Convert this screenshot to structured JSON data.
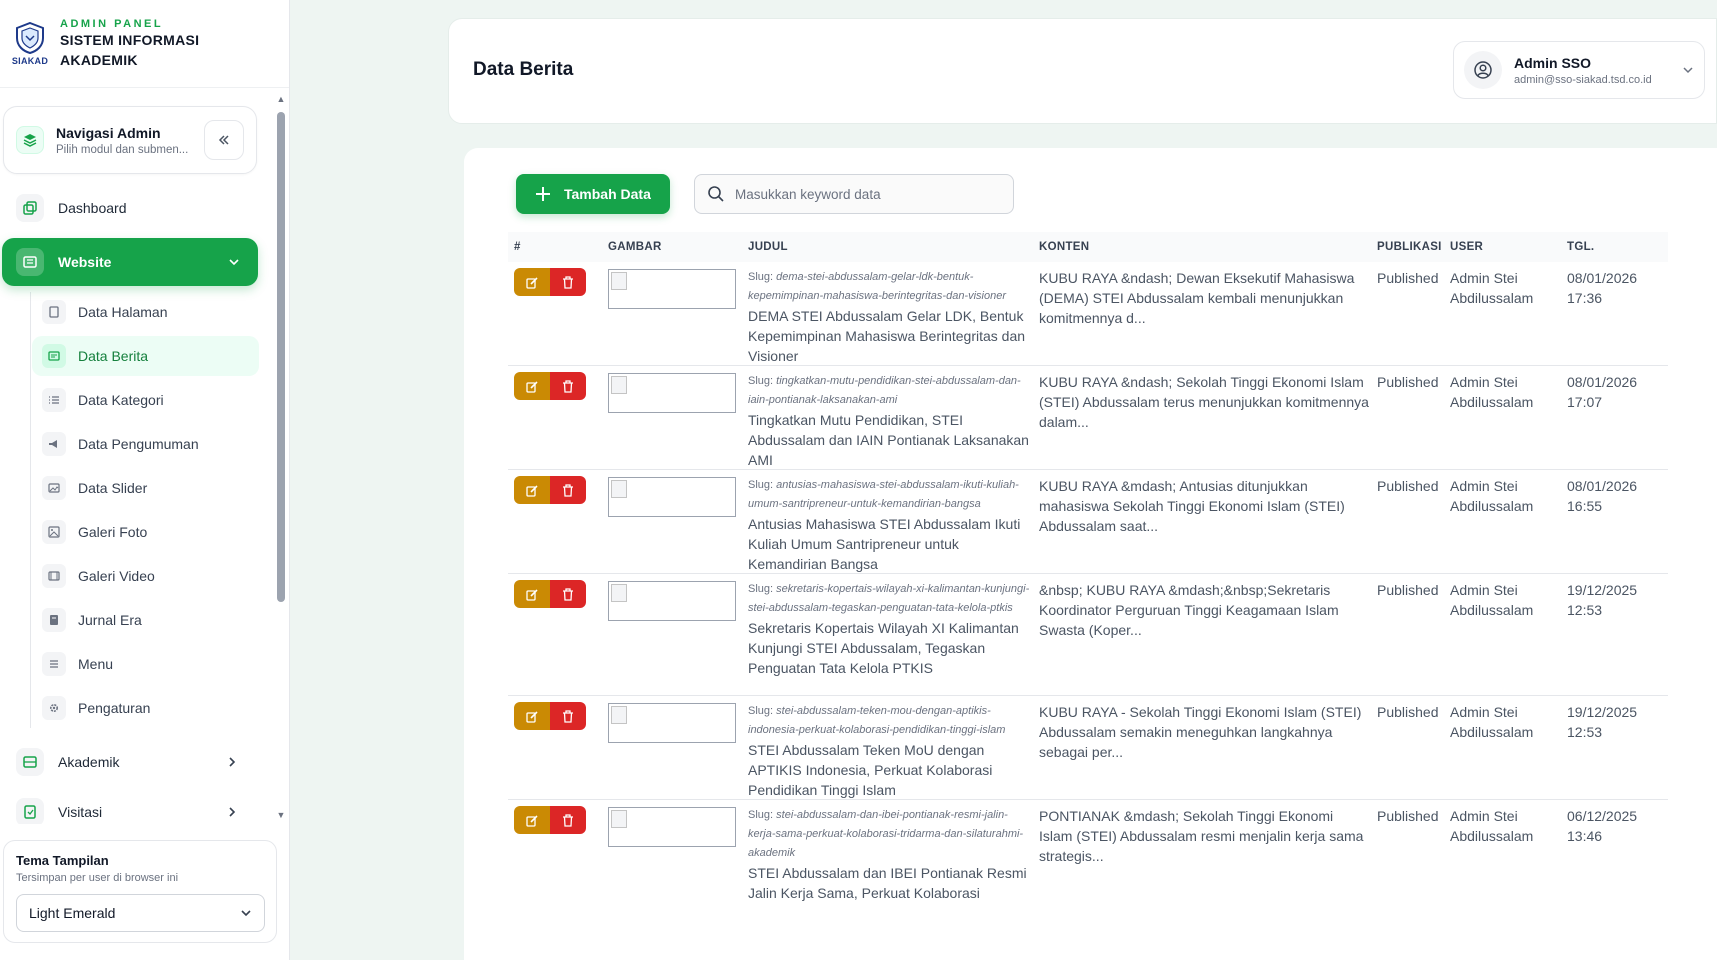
{
  "brand": {
    "logo_text": "SIAKAD",
    "kicker": "ADMIN PANEL",
    "title_line1": "SISTEM INFORMASI",
    "title_line2": "AKADEMIK"
  },
  "nav_card": {
    "title": "Navigasi Admin",
    "subtitle": "Pilih modul dan submen..."
  },
  "menu": {
    "dashboard": "Dashboard",
    "website": "Website",
    "akademik": "Akademik",
    "visitasi": "Visitasi"
  },
  "submenu": [
    {
      "label": "Data Halaman",
      "icon": "page-icon"
    },
    {
      "label": "Data Berita",
      "icon": "news-icon"
    },
    {
      "label": "Data Kategori",
      "icon": "list-icon"
    },
    {
      "label": "Data Pengumuman",
      "icon": "megaphone-icon"
    },
    {
      "label": "Data Slider",
      "icon": "slider-icon"
    },
    {
      "label": "Galeri Foto",
      "icon": "photo-icon"
    },
    {
      "label": "Galeri Video",
      "icon": "video-icon"
    },
    {
      "label": "Jurnal Era",
      "icon": "journal-icon"
    },
    {
      "label": "Menu",
      "icon": "menu-icon"
    },
    {
      "label": "Pengaturan",
      "icon": "gear-icon"
    }
  ],
  "theme": {
    "title": "Tema Tampilan",
    "subtitle": "Tersimpan per user di browser ini",
    "selected": "Light Emerald"
  },
  "header": {
    "title": "Data Berita",
    "user_name": "Admin SSO",
    "user_email": "admin@sso-siakad.tsd.co.id"
  },
  "toolbar": {
    "add_label": "Tambah Data",
    "search_placeholder": "Masukkan keyword data"
  },
  "table": {
    "columns": [
      "#",
      "GAMBAR",
      "JUDUL",
      "KONTEN",
      "PUBLIKASI",
      "USER",
      "TGL."
    ],
    "slug_prefix": "Slug:",
    "rows": [
      {
        "slug": "dema-stei-abdussalam-gelar-ldk-bentuk-kepemimpinan-mahasiswa-berintegritas-dan-visioner",
        "title": "DEMA STEI Abdussalam Gelar LDK, Bentuk Kepemimpinan Mahasiswa Berintegritas dan Visioner",
        "content": "KUBU RAYA &ndash; Dewan Eksekutif Mahasiswa (DEMA) STEI Abdussalam kembali menunjukkan komitmennya d...",
        "status": "Published",
        "user": "Admin Stei Abdilussalam",
        "date": "08/01/2026",
        "time": "17:36"
      },
      {
        "slug": "tingkatkan-mutu-pendidikan-stei-abdussalam-dan-iain-pontianak-laksanakan-ami",
        "title": "Tingkatkan Mutu Pendidikan, STEI Abdussalam dan IAIN Pontianak Laksanakan AMI",
        "content": "KUBU RAYA &ndash; Sekolah Tinggi Ekonomi Islam (STEI) Abdussalam terus menunjukkan komitmennya dalam...",
        "status": "Published",
        "user": "Admin Stei Abdilussalam",
        "date": "08/01/2026",
        "time": "17:07"
      },
      {
        "slug": "antusias-mahasiswa-stei-abdussalam-ikuti-kuliah-umum-santripreneur-untuk-kemandirian-bangsa",
        "title": "Antusias Mahasiswa STEI Abdussalam Ikuti Kuliah Umum Santripreneur untuk Kemandirian Bangsa",
        "content": "KUBU RAYA &mdash; Antusias ditunjukkan mahasiswa Sekolah Tinggi Ekonomi Islam (STEI) Abdussalam saat...",
        "status": "Published",
        "user": "Admin Stei Abdilussalam",
        "date": "08/01/2026",
        "time": "16:55"
      },
      {
        "slug": "sekretaris-kopertais-wilayah-xi-kalimantan-kunjungi-stei-abdussalam-tegaskan-penguatan-tata-kelola-ptkis",
        "title": "Sekretaris Kopertais Wilayah XI Kalimantan Kunjungi STEI Abdussalam, Tegaskan Penguatan Tata Kelola PTKIS",
        "content": "&nbsp; KUBU RAYA &mdash;&nbsp;Sekretaris Koordinator Perguruan Tinggi Keagamaan Islam Swasta (Koper...",
        "status": "Published",
        "user": "Admin Stei Abdilussalam",
        "date": "19/12/2025",
        "time": "12:53"
      },
      {
        "slug": "stei-abdussalam-teken-mou-dengan-aptikis-indonesia-perkuat-kolaborasi-pendidikan-tinggi-islam",
        "title": "STEI Abdussalam Teken MoU dengan APTIKIS Indonesia, Perkuat Kolaborasi Pendidikan Tinggi Islam",
        "content": "KUBU RAYA - Sekolah Tinggi Ekonomi Islam (STEI) Abdussalam semakin meneguhkan langkahnya sebagai per...",
        "status": "Published",
        "user": "Admin Stei Abdilussalam",
        "date": "19/12/2025",
        "time": "12:53"
      },
      {
        "slug": "stei-abdussalam-dan-ibei-pontianak-resmi-jalin-kerja-sama-perkuat-kolaborasi-tridarma-dan-silaturahmi-akademik",
        "title": "STEI Abdussalam dan IBEI Pontianak Resmi Jalin Kerja Sama, Perkuat Kolaborasi",
        "content": "PONTIANAK &mdash; Sekolah Tinggi Ekonomi Islam (STEI) Abdussalam resmi menjalin kerja sama strategis...",
        "status": "Published",
        "user": "Admin Stei Abdilussalam",
        "date": "06/12/2025",
        "time": "13:46"
      }
    ]
  },
  "colors": {
    "accent": "#16a34a",
    "edit": "#ca8a04",
    "delete": "#dc2626"
  }
}
